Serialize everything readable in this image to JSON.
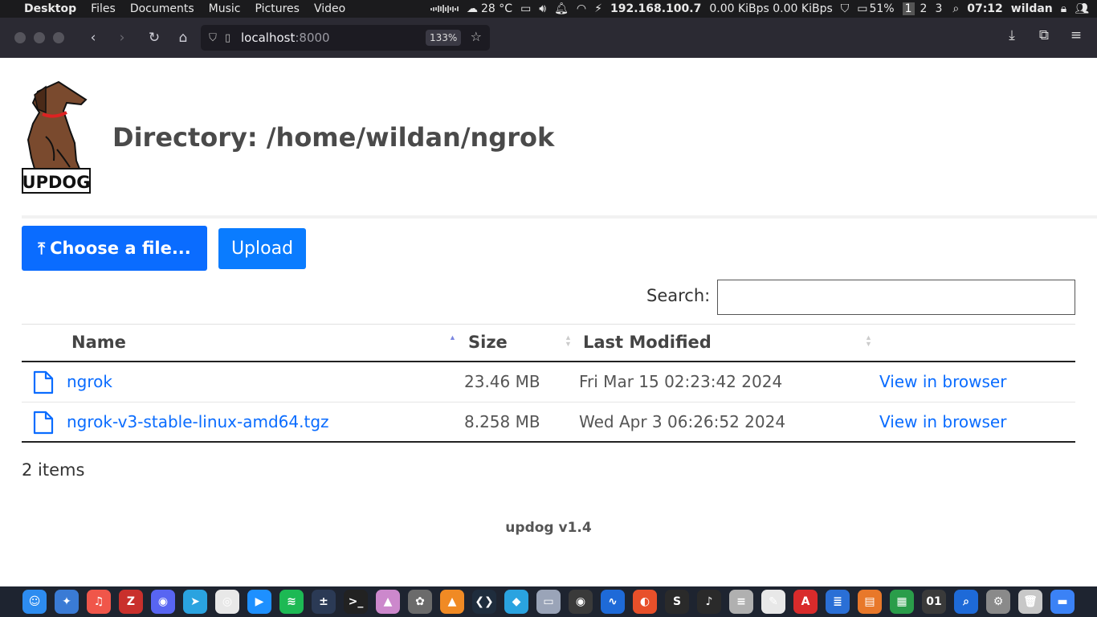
{
  "system_bar": {
    "menus": [
      "Desktop",
      "Files",
      "Documents",
      "Music",
      "Pictures",
      "Video"
    ],
    "weather": "28 °C",
    "ip": "192.168.100.7",
    "net_speed": "0.00 KiBps 0.00 KiBps",
    "battery": "51%",
    "workspaces": [
      "1",
      "2",
      "3"
    ],
    "active_workspace": "1",
    "time": "07:12",
    "user": "wildan"
  },
  "browser": {
    "url_host": "localhost",
    "url_port": ":8000",
    "zoom": "133%"
  },
  "page": {
    "logo_text": "UPDOG",
    "directory_title": "Directory: /home/wildan/ngrok",
    "choose_label": "Choose a file...",
    "upload_label": "Upload",
    "search_label": "Search:",
    "search_value": "",
    "columns": [
      "Name",
      "Size",
      "Last Modified"
    ],
    "files": [
      {
        "name": "ngrok",
        "size": "23.46 MB",
        "modified": "Fri Mar 15 02:23:42 2024",
        "action": "View in browser"
      },
      {
        "name": "ngrok-v3-stable-linux-amd64.tgz",
        "size": "8.258 MB",
        "modified": "Wed Apr 3 06:26:52 2024",
        "action": "View in browser"
      }
    ],
    "items_count": "2 items",
    "footer": "updog v1.4"
  },
  "dock": {
    "apps": [
      {
        "icon": "finder-icon",
        "color": "#2d8cf0",
        "glyph": "☺"
      },
      {
        "icon": "safari-icon",
        "color": "#3a7bd5",
        "glyph": "✦"
      },
      {
        "icon": "music-icon",
        "color": "#f0564a",
        "glyph": "♫"
      },
      {
        "icon": "filezilla-icon",
        "color": "#c9302c",
        "glyph": "Z"
      },
      {
        "icon": "discord-icon",
        "color": "#5865f2",
        "glyph": "◉"
      },
      {
        "icon": "telegram-icon",
        "color": "#2aa3e0",
        "glyph": "➤"
      },
      {
        "icon": "camera-icon",
        "color": "#e8e8e8",
        "glyph": "◎"
      },
      {
        "icon": "media-player-icon",
        "color": "#1e90ff",
        "glyph": "▶"
      },
      {
        "icon": "spotify-icon",
        "color": "#1db954",
        "glyph": "≋"
      },
      {
        "icon": "calculator-icon",
        "color": "#2b3a55",
        "glyph": "±"
      },
      {
        "icon": "terminal-icon",
        "color": "#222222",
        "glyph": ">_"
      },
      {
        "icon": "inkscape-icon",
        "color": "#cc88cc",
        "glyph": "▲"
      },
      {
        "icon": "gimp-icon",
        "color": "#6b6b6b",
        "glyph": "✿"
      },
      {
        "icon": "vlc-icon",
        "color": "#f08a24",
        "glyph": "▲"
      },
      {
        "icon": "vscode-icon",
        "color": "#1f2d3d",
        "glyph": "❮❯"
      },
      {
        "icon": "virtualbox-icon",
        "color": "#2aa3e0",
        "glyph": "◆"
      },
      {
        "icon": "display-settings-icon",
        "color": "#9aa4b8",
        "glyph": "▭"
      },
      {
        "icon": "screenshot-icon",
        "color": "#3a3a3a",
        "glyph": "◉"
      },
      {
        "icon": "wave-icon",
        "color": "#1e6ad8",
        "glyph": "∿"
      },
      {
        "icon": "firefox-icon",
        "color": "#e8502a",
        "glyph": "◐"
      },
      {
        "icon": "sublime-icon",
        "color": "#2a2a2a",
        "glyph": "S"
      },
      {
        "icon": "itunes-icon",
        "color": "#2a2a2a",
        "glyph": "♪"
      },
      {
        "icon": "database-icon",
        "color": "#b0b0b0",
        "glyph": "≡"
      },
      {
        "icon": "text-editor-icon",
        "color": "#e8e8e8",
        "glyph": "✎"
      },
      {
        "icon": "pdf-icon",
        "color": "#d92b2b",
        "glyph": "A"
      },
      {
        "icon": "document-icon",
        "color": "#2a6fd6",
        "glyph": "≣"
      },
      {
        "icon": "presentation-icon",
        "color": "#e8782a",
        "glyph": "▤"
      },
      {
        "icon": "spreadsheet-icon",
        "color": "#2a9d4a",
        "glyph": "▦"
      },
      {
        "icon": "hex-editor-icon",
        "color": "#3a3a3a",
        "glyph": "01"
      },
      {
        "icon": "search-app-icon",
        "color": "#1e6ad8",
        "glyph": "⌕"
      },
      {
        "icon": "system-settings-icon",
        "color": "#8a8a8a",
        "glyph": "⚙"
      },
      {
        "icon": "trash-icon",
        "color": "#c8c8c8",
        "glyph": "🗑"
      },
      {
        "icon": "app-grid-icon",
        "color": "#3b82f6",
        "glyph": "▬"
      }
    ]
  }
}
